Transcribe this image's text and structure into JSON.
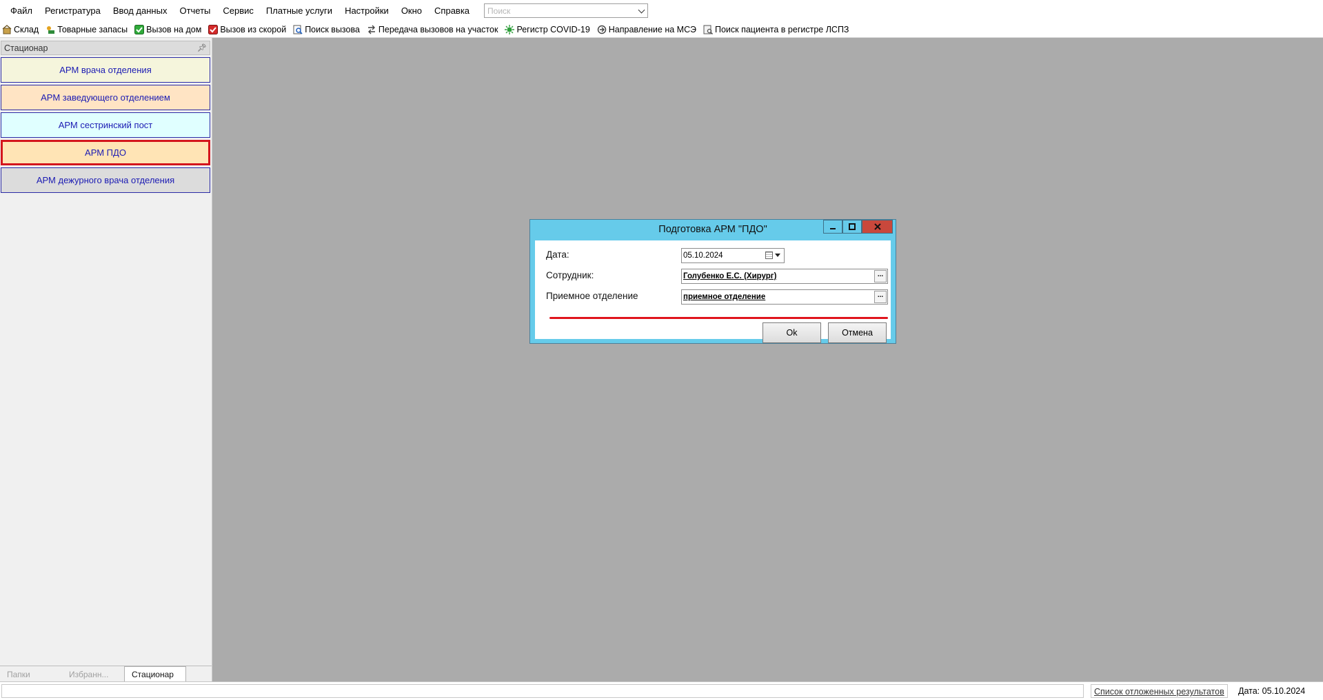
{
  "menu": {
    "items": [
      "Файл",
      "Регистратура",
      "Ввод данных",
      "Отчеты",
      "Сервис",
      "Платные услуги",
      "Настройки",
      "Окно",
      "Справка"
    ],
    "search_placeholder": "Поиск"
  },
  "toolbar": {
    "items": [
      {
        "label": "Склад",
        "icon": "warehouse-icon"
      },
      {
        "label": "Товарные запасы",
        "icon": "stock-icon"
      },
      {
        "label": "Вызов на дом",
        "icon": "check-icon"
      },
      {
        "label": "Вызов из скорой",
        "icon": "check-icon"
      },
      {
        "label": "Поиск вызова",
        "icon": "search-icon"
      },
      {
        "label": "Передача вызовов на участок",
        "icon": "transfer-icon"
      },
      {
        "label": "Регистр COVID-19",
        "icon": "virus-icon"
      },
      {
        "label": "Направление на МСЭ",
        "icon": "referral-icon"
      },
      {
        "label": "Поиск пациента в регистре ЛСПЗ",
        "icon": "patient-search-icon"
      }
    ]
  },
  "left_panel": {
    "title": "Стационар",
    "buttons": [
      {
        "label": "АРМ врача отделения",
        "color": "#f5f5dc"
      },
      {
        "label": "АРМ заведующего отделением",
        "color": "#ffe4c4"
      },
      {
        "label": "АРМ сестринский пост",
        "color": "#e0ffff"
      },
      {
        "label": "АРМ ПДО",
        "color": "#ffe4b5",
        "selected": true
      },
      {
        "label": "АРМ дежурного врача отделения",
        "color": "#dcdcdc"
      }
    ],
    "tabs": [
      "Папки",
      "Избранн...",
      "Стационар"
    ],
    "active_tab": "Стационар"
  },
  "dialog": {
    "title": "Подготовка АРМ \"ПДО\"",
    "date_label": "Дата:",
    "date_value": "05.10.2024",
    "employee_label": "Сотрудник:",
    "employee_value": "Голубенко Е.С. (Хирург)",
    "department_label": "Приемное отделение",
    "department_value": "приемное отделение",
    "ellipsis": "...",
    "ok_label": "Ok",
    "cancel_label": "Отмена"
  },
  "statusbar": {
    "deferred_link": "Список отложенных результатов",
    "date_text": "Дата: 05.10.2024"
  },
  "colors": {
    "dialog_title_bg": "#66cbea",
    "close_button": "#c9483c",
    "accent_red": "#e0141c",
    "link_blue": "#1b1bb3"
  }
}
